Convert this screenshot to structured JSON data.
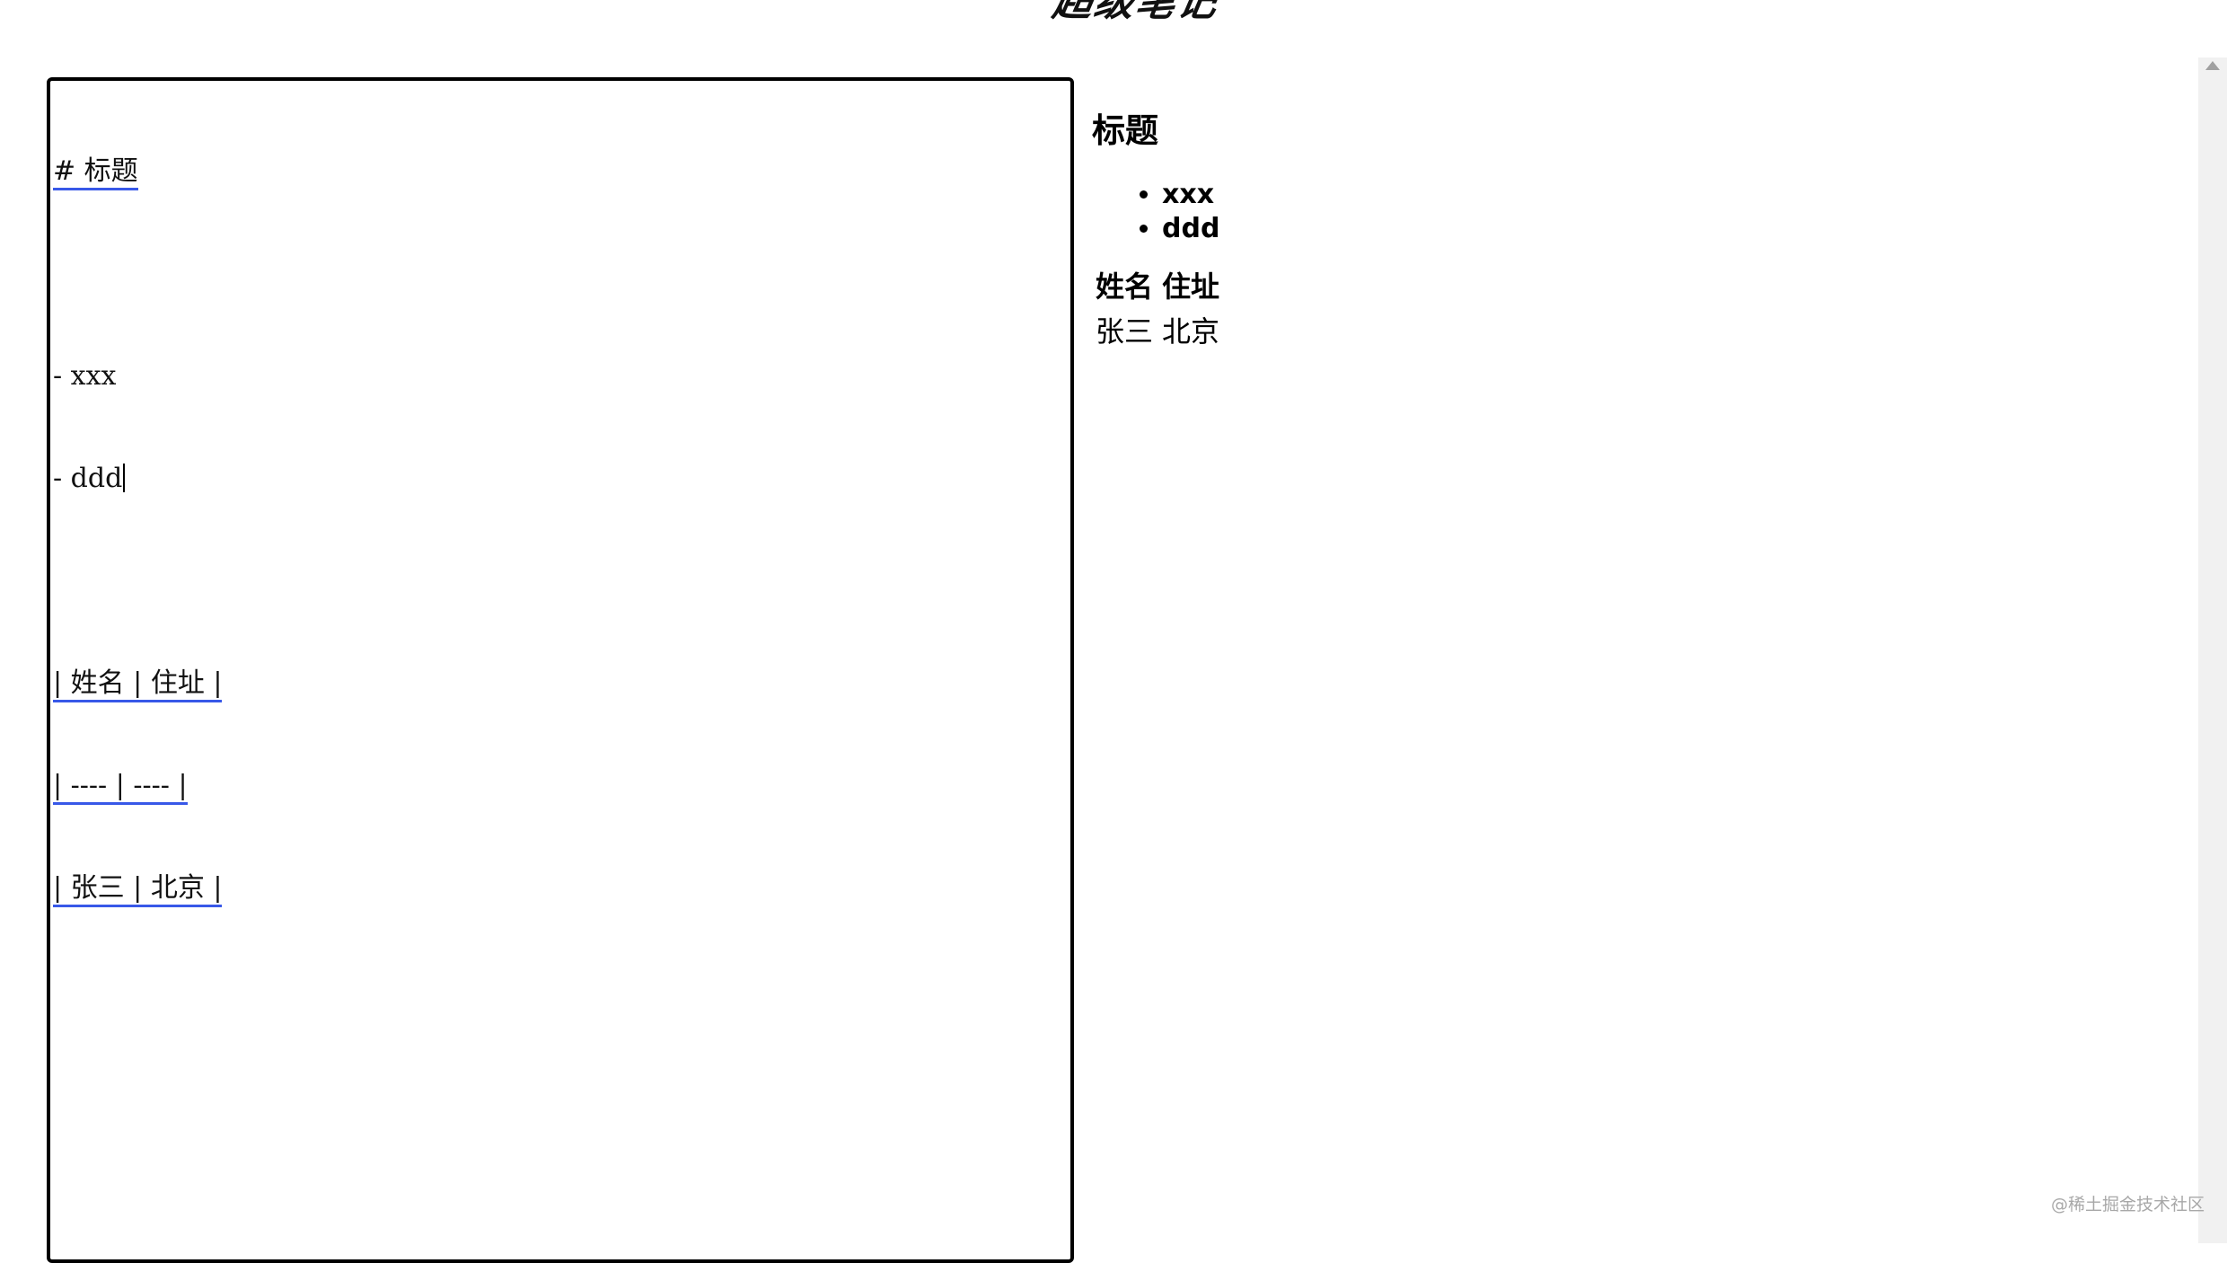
{
  "header": {
    "logo_text": "超级笔记"
  },
  "editor": {
    "lines": [
      {
        "text": "# 标题",
        "underline": true
      },
      {
        "text": "",
        "underline": false
      },
      {
        "text": "- xxx",
        "underline": false
      },
      {
        "text": "- ddd",
        "underline": false,
        "caret": true
      },
      {
        "text": "",
        "underline": false
      },
      {
        "text": "| 姓名 | 住址 |",
        "underline": true
      },
      {
        "text": "| ---- | ---- |",
        "underline": true
      },
      {
        "text": "| 张三 | 北京 |",
        "underline": true
      }
    ]
  },
  "preview": {
    "heading": "标题",
    "list_items": [
      "xxx",
      "ddd"
    ],
    "table": {
      "headers": [
        "姓名",
        "住址"
      ],
      "rows": [
        [
          "张三",
          "北京"
        ]
      ]
    }
  },
  "watermark": "@稀土掘金技术社区",
  "colors": {
    "underline": "#3858e8",
    "border": "#000000",
    "watermark": "#a8a8a8"
  }
}
